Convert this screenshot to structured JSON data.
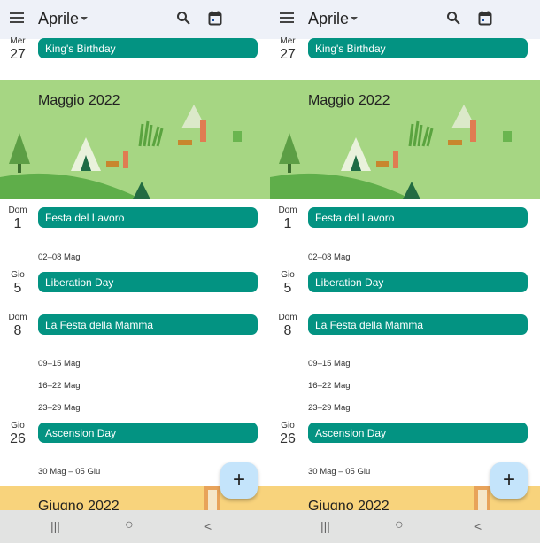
{
  "header": {
    "month": "Aprile",
    "icons": [
      "menu-icon",
      "search-icon",
      "calendar-today-icon"
    ]
  },
  "top_event": {
    "day_name": "Mer",
    "day_num": "27",
    "title": "King's Birthday"
  },
  "may_banner": {
    "title": "Maggio 2022"
  },
  "events": [
    {
      "day_name": "Dom",
      "day_num": "1",
      "title": "Festa del Lavoro"
    },
    {
      "day_name": "Gio",
      "day_num": "5",
      "title": "Liberation Day"
    },
    {
      "day_name": "Dom",
      "day_num": "8",
      "title": "La Festa della Mamma"
    },
    {
      "day_name": "Gio",
      "day_num": "26",
      "title": "Ascension Day"
    }
  ],
  "weeks": [
    "02–08 Mag",
    "09–15 Mag",
    "16–22 Mag",
    "23–29 Mag",
    "30 Mag – 05 Giu"
  ],
  "june_banner": {
    "title": "Giugno 2022"
  },
  "fab": {
    "label": "+"
  },
  "nav": {
    "recent": "|||",
    "home": "○",
    "back": "<"
  },
  "colors": {
    "event": "#039382",
    "header": "#eef1f8",
    "may_banner": "#a6d683",
    "june_banner": "#f8d37c",
    "fab": "#c4e4fb"
  }
}
